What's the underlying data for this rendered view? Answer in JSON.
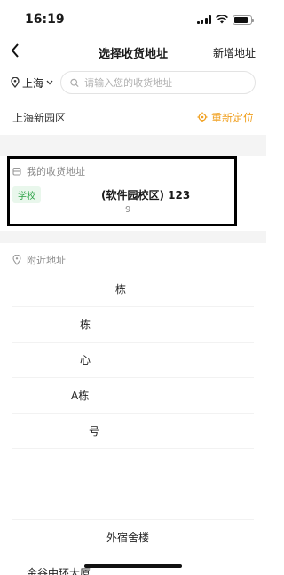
{
  "status_bar": {
    "time": "16:19",
    "battery_level": 0.85
  },
  "nav": {
    "title": "选择收货地址",
    "action": "新增地址"
  },
  "search": {
    "city": "上海",
    "placeholder": "请输入您的收货地址"
  },
  "current_location": {
    "address": "上海新园区",
    "relocate_label": "重新定位"
  },
  "my_addresses": {
    "section_title": "我的收货地址",
    "items": [
      {
        "tag": "学校",
        "address": "(软件园校区) 123",
        "sub": "9"
      }
    ]
  },
  "nearby": {
    "section_title": "附近地址",
    "items": [
      {
        "name": "栋"
      },
      {
        "name": "栋"
      },
      {
        "name": "心"
      },
      {
        "name": "A栋"
      },
      {
        "name": "号"
      },
      {
        "name": ""
      },
      {
        "name": ""
      },
      {
        "name": "外宿舍楼"
      },
      {
        "name": "金谷中环大厦"
      }
    ]
  }
}
